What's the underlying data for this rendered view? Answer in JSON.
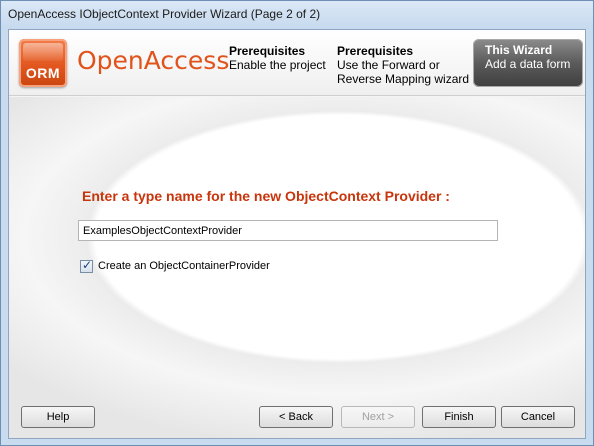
{
  "window": {
    "title": "OpenAccess IObjectContext Provider Wizard (Page 2 of 2)"
  },
  "header": {
    "logo_text": "ORM",
    "brand": "OpenAccess",
    "steps": [
      {
        "title": "Prerequisites",
        "description": "Enable the project"
      },
      {
        "title": "Prerequisites",
        "description_line1": "Use the Forward or",
        "description_line2": "Reverse Mapping wizard"
      },
      {
        "title": "This Wizard",
        "description": "Add a data form",
        "active": true
      }
    ]
  },
  "form": {
    "prompt": "Enter a type name for the new ObjectContext Provider :",
    "type_name_value": "ExamplesObjectContextProvider",
    "checkbox_label": "Create an ObjectContainerProvider",
    "checkbox_checked": true
  },
  "buttons": {
    "help": "Help",
    "back": "< Back",
    "next": "Next >",
    "finish": "Finish",
    "cancel": "Cancel"
  },
  "colors": {
    "brand_orange": "#e0531b",
    "prompt_red": "#c8350c",
    "active_step_bg": "#5b5b5b"
  }
}
